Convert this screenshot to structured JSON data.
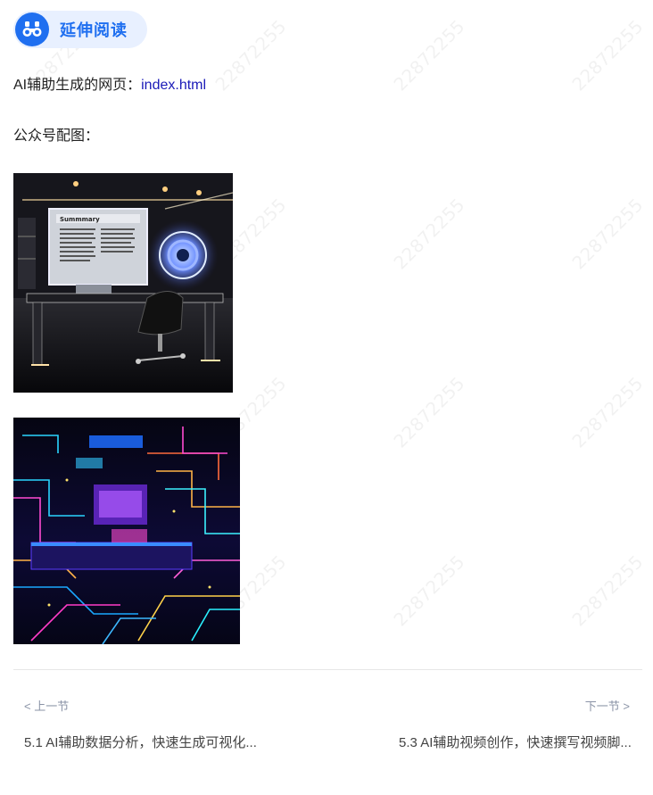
{
  "badge": {
    "icon": "binoculars-icon",
    "label": "延伸阅读",
    "accent": "#1f6ff0",
    "background": "#e8f0ff"
  },
  "content": {
    "webpage_prefix": "AI辅助生成的网页：",
    "webpage_link": "index.html",
    "images_heading": "公众号配图："
  },
  "images": [
    {
      "name": "ai-summary-desk-illustration",
      "screen_text": "Summmary"
    },
    {
      "name": "neon-circuit-room-illustration"
    }
  ],
  "watermark": {
    "text": "22872255"
  },
  "nav": {
    "prev_label": "< 上一节",
    "next_label": "下一节 >",
    "prev_title": "5.1 AI辅助数据分析，快速生成可视化...",
    "next_title": "5.3 AI辅助视频创作，快速撰写视频脚..."
  }
}
